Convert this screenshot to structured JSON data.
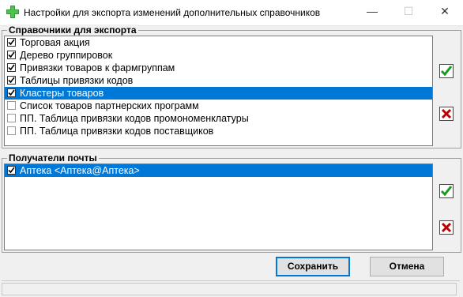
{
  "window": {
    "title": "Настройки для экспорта изменений дополнительных справочников",
    "minimize_glyph": "—",
    "maximize_glyph": "☐",
    "close_glyph": "✕",
    "app_icon": "green-cross-icon"
  },
  "export_group": {
    "label": "Справочники  для экспорта",
    "items": [
      {
        "label": "Торговая акция",
        "checked": true,
        "selected": false
      },
      {
        "label": "Дерево группировок",
        "checked": true,
        "selected": false
      },
      {
        "label": "Привязки товаров к фармгруппам",
        "checked": true,
        "selected": false
      },
      {
        "label": "Таблицы привязки кодов",
        "checked": true,
        "selected": false
      },
      {
        "label": "Кластеры товаров",
        "checked": true,
        "selected": true
      },
      {
        "label": "Список товаров партнерских программ",
        "checked": false,
        "selected": false
      },
      {
        "label": "ПП. Таблица привязки кодов промономенклатуры",
        "checked": false,
        "selected": false
      },
      {
        "label": "ПП. Таблица привязки кодов поставщиков",
        "checked": false,
        "selected": false
      }
    ],
    "check_all_icon": "green-checkmark-icon",
    "uncheck_all_icon": "red-cross-icon"
  },
  "mail_group": {
    "label": "Получатели почты",
    "items": [
      {
        "label": "Аптека <Аптека@Аптека>",
        "checked": true,
        "selected": true
      }
    ],
    "check_all_icon": "green-checkmark-icon",
    "uncheck_all_icon": "red-cross-icon"
  },
  "buttons": {
    "save_label": "Сохранить",
    "cancel_label": "Отмена"
  },
  "colors": {
    "selection": "#0078d7",
    "check_green": "#1a9a1a",
    "cross_red": "#c00000"
  }
}
